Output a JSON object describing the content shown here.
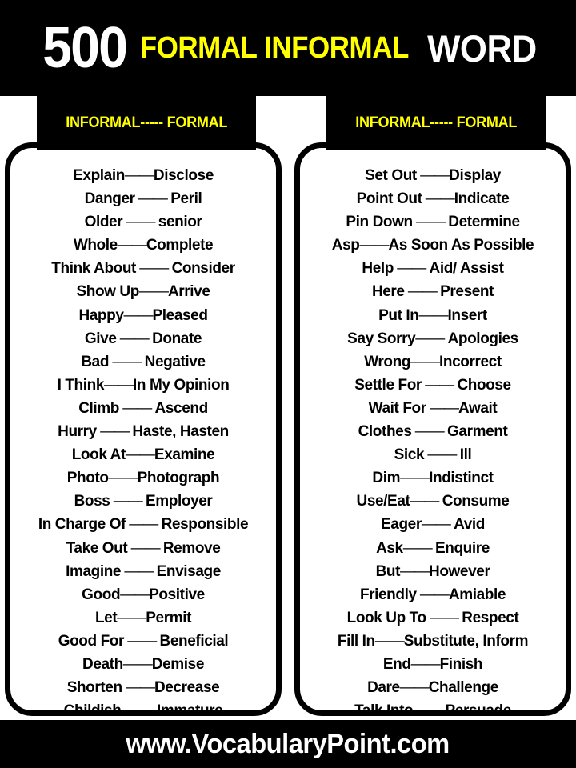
{
  "title": {
    "count": "500",
    "middle": "FORMAL INFORMAL",
    "word": "WORD",
    "count_color": "#ffffff",
    "middle_color": "#ffff00",
    "word_color": "#ffffff"
  },
  "colors": {
    "background": "#000000",
    "card": "#ffffff",
    "accent_yellow": "#ffff00",
    "text": "#000000"
  },
  "columns": [
    {
      "header": "INFORMAL----- FORMAL",
      "rows": [
        {
          "informal": "Explain",
          "dash": "——",
          "formal": "Disclose"
        },
        {
          "informal": "Danger",
          "dash": " —— ",
          "formal": "Peril"
        },
        {
          "informal": "Older",
          "dash": " —— ",
          "formal": "senior"
        },
        {
          "informal": "Whole",
          "dash": "——",
          "formal": "Complete"
        },
        {
          "informal": "Think About",
          "dash": " —— ",
          "formal": "Consider"
        },
        {
          "informal": "Show Up",
          "dash": "——",
          "formal": "Arrive"
        },
        {
          "informal": "Happy",
          "dash": "——",
          "formal": "Pleased"
        },
        {
          "informal": "Give",
          "dash": " —— ",
          "formal": "Donate"
        },
        {
          "informal": "Bad",
          "dash": " —— ",
          "formal": "Negative"
        },
        {
          "informal": "I Think",
          "dash": "——",
          "formal": "In My Opinion"
        },
        {
          "informal": "Climb",
          "dash": " —— ",
          "formal": "Ascend"
        },
        {
          "informal": "Hurry",
          "dash": " —— ",
          "formal": "Haste, Hasten"
        },
        {
          "informal": "Look At",
          "dash": "——",
          "formal": "Examine"
        },
        {
          "informal": "Photo",
          "dash": "——",
          "formal": "Photograph"
        },
        {
          "informal": "Boss",
          "dash": " —— ",
          "formal": "Employer"
        },
        {
          "informal": "In Charge Of",
          "dash": " —— ",
          "formal": "Responsible"
        },
        {
          "informal": "Take Out",
          "dash": " —— ",
          "formal": "Remove"
        },
        {
          "informal": "Imagine",
          "dash": " —— ",
          "formal": "Envisage"
        },
        {
          "informal": "Good",
          "dash": "——",
          "formal": "Positive"
        },
        {
          "informal": "Let",
          "dash": "——",
          "formal": "Permit"
        },
        {
          "informal": "Good For",
          "dash": " —— ",
          "formal": "Beneficial"
        },
        {
          "informal": "Death",
          "dash": "——",
          "formal": "Demise"
        },
        {
          "informal": "Shorten",
          "dash": " ——",
          "formal": "Decrease"
        },
        {
          "informal": "Childish",
          "dash": " —— ",
          "formal": "Immature"
        }
      ]
    },
    {
      "header": "INFORMAL----- FORMAL",
      "rows": [
        {
          "informal": "Set Out",
          "dash": " ——",
          "formal": "Display"
        },
        {
          "informal": "Point Out",
          "dash": " ——",
          "formal": "Indicate"
        },
        {
          "informal": "Pin Down",
          "dash": " —— ",
          "formal": "Determine"
        },
        {
          "informal": "Asp",
          "dash": "——",
          "formal": "As Soon As Possible"
        },
        {
          "informal": "Help",
          "dash": " —— ",
          "formal": "Aid/ Assist"
        },
        {
          "informal": "Here",
          "dash": " —— ",
          "formal": "Present"
        },
        {
          "informal": "Put In",
          "dash": "——",
          "formal": "Insert"
        },
        {
          "informal": "Say Sorry",
          "dash": "—— ",
          "formal": "Apologies"
        },
        {
          "informal": "Wrong",
          "dash": "——",
          "formal": "Incorrect"
        },
        {
          "informal": "Settle For",
          "dash": " —— ",
          "formal": "Choose"
        },
        {
          "informal": "Wait For",
          "dash": " ——",
          "formal": "Await"
        },
        {
          "informal": "Clothes",
          "dash": " —— ",
          "formal": "Garment"
        },
        {
          "informal": "Sick",
          "dash": " —— ",
          "formal": "Ill"
        },
        {
          "informal": "Dim",
          "dash": "——",
          "formal": "Indistinct"
        },
        {
          "informal": "Use/Eat",
          "dash": "—— ",
          "formal": "Consume"
        },
        {
          "informal": "Eager",
          "dash": "—— ",
          "formal": "Avid"
        },
        {
          "informal": "Ask",
          "dash": "—— ",
          "formal": "Enquire"
        },
        {
          "informal": "But",
          "dash": "——",
          "formal": "However"
        },
        {
          "informal": "Friendly",
          "dash": " ——",
          "formal": "Amiable"
        },
        {
          "informal": "Look Up To",
          "dash": " —— ",
          "formal": "Respect"
        },
        {
          "informal": "Fill In",
          "dash": "——",
          "formal": "Substitute, Inform"
        },
        {
          "informal": "End",
          "dash": "——",
          "formal": "Finish"
        },
        {
          "informal": "Dare",
          "dash": "——",
          "formal": "Challenge"
        },
        {
          "informal": "Talk Into",
          "dash": " ——",
          "formal": "Persuade"
        }
      ]
    }
  ],
  "footer": {
    "website": "www.VocabularyPoint.com"
  }
}
